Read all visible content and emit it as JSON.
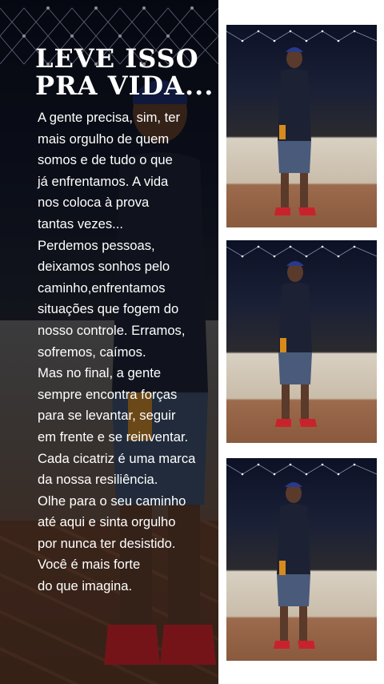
{
  "post": {
    "title": "LEVE ISSO\nPRA VIDA...",
    "body": "A gente precisa, sim, ter\nmais orgulho de quem\nsomos e de tudo o que\njá enfrentamos. A vida\nnos coloca à prova\ntantas vezes...\nPerdemos pessoas,\ndeixamos sonhos pelo\ncaminho,enfrentamos\nsituações que fogem do\nnosso controle. Erramos,\nsofremos, caímos.\nMas no final, a gente\nsempre encontra forças\npara se levantar, seguir\nem frente e se reinventar.\nCada cicatriz é uma marca\nda nossa resiliência.\nOlhe para o seu caminho\naté aqui e sinta orgulho\npor nunca ter desistido.\nVocê é mais forte\ndo que imagina."
  },
  "photos": [
    {
      "name": "photo-1"
    },
    {
      "name": "photo-2"
    },
    {
      "name": "photo-3"
    }
  ],
  "colors": {
    "background": "#ffffff",
    "text": "#ffffff",
    "shirt": "#1c2233",
    "cap": "#2a3a8a",
    "sneakers": "#c8232c"
  }
}
